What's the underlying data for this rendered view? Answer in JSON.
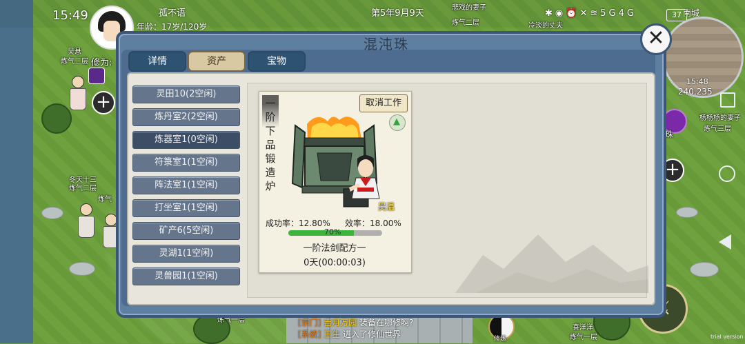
{
  "status": {
    "time": "15:49",
    "battery": "37",
    "icons": [
      "bluetooth-icon",
      "eye-icon",
      "alarm-icon",
      "mute-icon",
      "wifi-icon",
      "5g-signal-icon",
      "4g-signal-icon"
    ],
    "signal_text": "5G",
    "signal_text_2": "4G"
  },
  "player": {
    "name": "孤不语",
    "age": "年龄：17岁/120岁"
  },
  "game_date": "第5年9月9天",
  "map": {
    "city": "南城",
    "time": "15:48",
    "coords": "240,235"
  },
  "world_labels": {
    "left_npc_name": "吴悬",
    "left_npc_rank": "炼气二层",
    "left_npc_cult": "修为:",
    "left_mid_1": "冬天十三",
    "left_mid_2": "炼气二层",
    "left_mid_3": "炼气",
    "top_npc_1": "悲戏的妻子",
    "top_npc_2": "炼气二层",
    "top_npc_3": "冷淡的丈夫",
    "right_npc_1": "杨杨杨的妻子",
    "right_npc_2": "炼气三层",
    "bottom_npc_name": "喜洋洋",
    "bottom_npc_rank": "炼气一层",
    "bottom_left": "炼气一层",
    "spirit_label": "混沌珠",
    "taiji_label": "修炼"
  },
  "modal": {
    "title": "混沌珠",
    "tabs": [
      {
        "label": "详情",
        "active": false
      },
      {
        "label": "资产",
        "active": true
      },
      {
        "label": "宝物",
        "active": false
      }
    ],
    "side_items": [
      {
        "label": "灵田10(2空闲)",
        "selected": false
      },
      {
        "label": "炼丹室2(2空闲)",
        "selected": false
      },
      {
        "label": "炼器室1(0空闲)",
        "selected": true
      },
      {
        "label": "符箓室1(1空闲)",
        "selected": false
      },
      {
        "label": "阵法室1(1空闲)",
        "selected": false
      },
      {
        "label": "打坐室1(1空闲)",
        "selected": false
      },
      {
        "label": "矿产6(5空闲)",
        "selected": false
      },
      {
        "label": "灵湖1(1空闲)",
        "selected": false
      },
      {
        "label": "灵兽园1(1空闲)",
        "selected": false
      }
    ],
    "card": {
      "title": "一阶下品锻造炉",
      "cancel_label": "取消工作",
      "worker_name": "吴温",
      "success_rate": "成功率：12.80%",
      "efficiency": "效率：18.00%",
      "progress_percent": 70,
      "progress_label": "70%",
      "recipe": "一阶法剑配方一",
      "timer": "0天(00:00:03)"
    }
  },
  "chat": [
    {
      "tag": "[宗门]",
      "name": "吉月万园",
      "text": "装备在哪修啊?"
    },
    {
      "tag": "[系统]",
      "name": "王生",
      "text": "进入了修仙世界"
    }
  ],
  "watermark": "trial version",
  "colors": {
    "modal_frame": "#5f7fa0",
    "tab_active": "#d9c9a2",
    "progress": "#3cb43c",
    "worker_name": "#ffe45a"
  }
}
